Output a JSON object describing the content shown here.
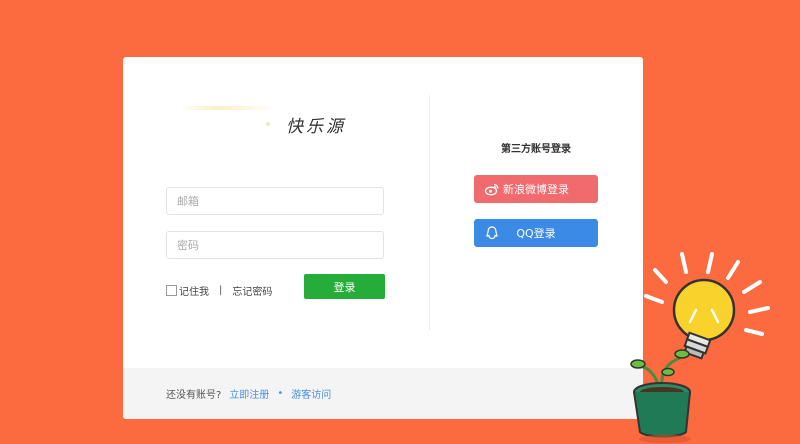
{
  "logo": {
    "text": "快乐源"
  },
  "form": {
    "email_placeholder": "邮箱",
    "password_placeholder": "密码",
    "remember_label": "记住我",
    "separator": "|",
    "forgot_label": "忘记密码",
    "login_label": "登录"
  },
  "third_party": {
    "title": "第三方账号登录",
    "weibo_label": "新浪微博登录",
    "qq_label": "QQ登录"
  },
  "footer": {
    "prompt": "还没有账号?",
    "register_label": "立即注册",
    "dot": "•",
    "guest_label": "游客访问"
  },
  "colors": {
    "background": "#fc6a3f",
    "login_button": "#26ad39",
    "weibo_button": "#f16a6d",
    "qq_button": "#3a8ae6",
    "link": "#4a90e2"
  }
}
